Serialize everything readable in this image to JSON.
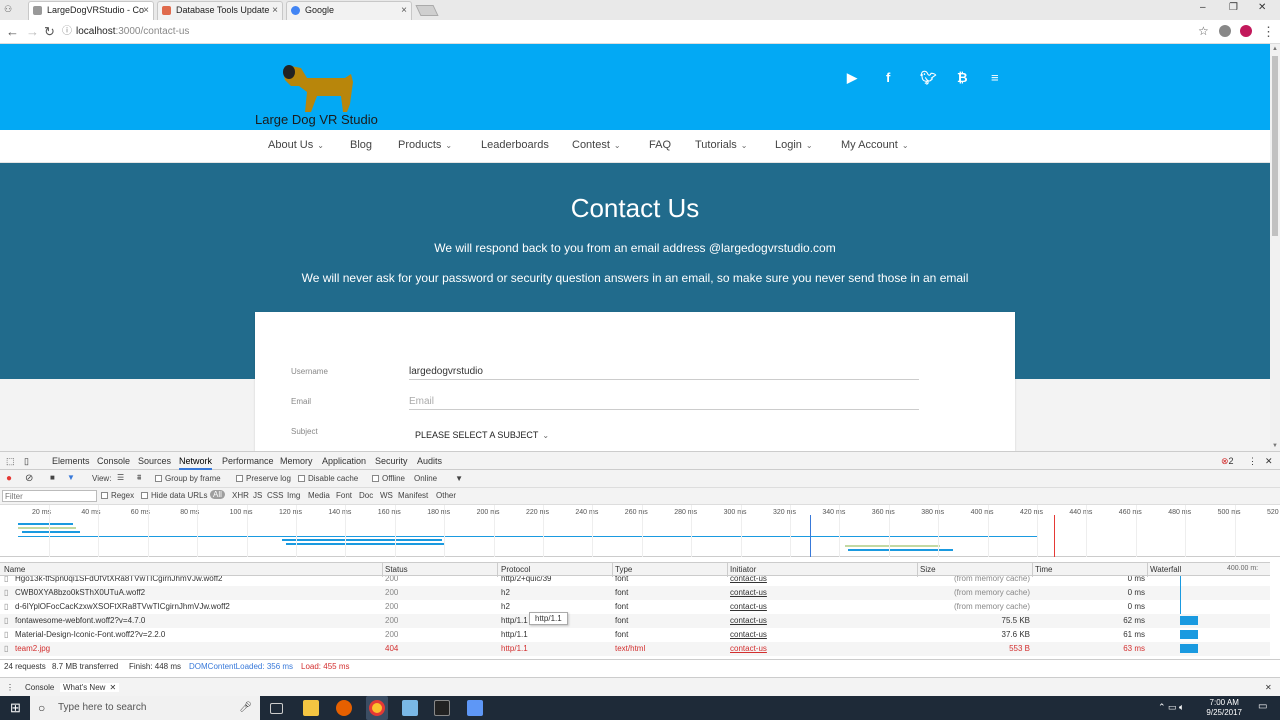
{
  "browser": {
    "tabs": [
      {
        "label": "LargeDogVRStudio - Co",
        "active": true
      },
      {
        "label": "Database Tools Update",
        "active": false
      },
      {
        "label": "Google",
        "active": false
      }
    ],
    "url_host": "localhost",
    "url_path": ":3000/contact-us"
  },
  "site": {
    "brand": "Large Dog VR Studio",
    "social": [
      "youtube-icon",
      "facebook-icon",
      "twitter-icon",
      "bitcoin-icon",
      "menu-icon"
    ],
    "nav": [
      "About Us",
      "Blog",
      "Products",
      "Leaderboards",
      "Contest",
      "FAQ",
      "Tutorials",
      "Login",
      "My Account"
    ],
    "hero": {
      "title": "Contact Us",
      "line1": "We will respond back to you from an email address @largedogvrstudio.com",
      "line2": "We will never ask for your password or security question answers in an email, so make sure you never send those in an email"
    },
    "form": {
      "username_label": "Username",
      "username_value": "largedogvrstudio",
      "email_label": "Email",
      "email_placeholder": "Email",
      "subject_label": "Subject",
      "subject_value": "PLEASE SELECT A SUBJECT"
    },
    "colors": {
      "header": "#03a9f4",
      "hero": "#216b8c"
    }
  },
  "devtools": {
    "tabs": [
      "Elements",
      "Console",
      "Sources",
      "Network",
      "Performance",
      "Memory",
      "Application",
      "Security",
      "Audits"
    ],
    "active_tab": "Network",
    "error_count": "2",
    "toolbar": {
      "view": "View:",
      "group_by_frame": "Group by frame",
      "preserve_log": "Preserve log",
      "disable_cache": "Disable cache",
      "offline": "Offline",
      "throttle": "Online"
    },
    "filter": {
      "placeholder": "Filter",
      "regex": "Regex",
      "hide_data_urls": "Hide data URLs",
      "types": [
        "All",
        "XHR",
        "JS",
        "CSS",
        "Img",
        "Media",
        "Font",
        "Doc",
        "WS",
        "Manifest",
        "Other"
      ]
    },
    "timeline_ticks": [
      "20 ms",
      "40 ms",
      "60 ms",
      "80 ms",
      "100 ms",
      "120 ms",
      "140 ms",
      "160 ms",
      "180 ms",
      "200 ms",
      "220 ms",
      "240 ms",
      "260 ms",
      "280 ms",
      "300 ms",
      "320 ms",
      "340 ms",
      "360 ms",
      "380 ms",
      "400 ms",
      "420 ms",
      "440 ms",
      "460 ms",
      "480 ms",
      "500 ms",
      "520"
    ],
    "columns": [
      "Name",
      "Status",
      "Protocol",
      "Type",
      "Initiator",
      "Size",
      "Time",
      "Waterfall"
    ],
    "waterfall_scale": "400.00 m:",
    "rows": [
      {
        "name": "Hgo13k-tfSpn0qi1SFdUfVtXRa8TVwTICgirnJhmVJw.woff2",
        "status": "200",
        "protocol": "http/2+quic/39",
        "type": "font",
        "initiator": "contact-us",
        "size": "(from memory cache)",
        "time": "0 ms",
        "wf_start": 0.133,
        "wf_width": 0.01,
        "error": false
      },
      {
        "name": "CWB0XYA8bzo0kSThX0UTuA.woff2",
        "status": "200",
        "protocol": "h2",
        "type": "font",
        "initiator": "contact-us",
        "size": "(from memory cache)",
        "time": "0 ms",
        "wf_start": 0.133,
        "wf_width": 0.01,
        "error": false
      },
      {
        "name": "d-6IYplOFocCacKzxwXSOFtXRa8TVwTICgirnJhmVJw.woff2",
        "status": "200",
        "protocol": "h2",
        "type": "font",
        "initiator": "contact-us",
        "size": "(from memory cache)",
        "time": "0 ms",
        "wf_start": 0.133,
        "wf_width": 0.01,
        "error": false
      },
      {
        "name": "fontawesome-webfont.woff2?v=4.7.0",
        "status": "200",
        "protocol": "http/1.1",
        "type": "font",
        "initiator": "contact-us",
        "size": "75.5 KB",
        "time": "62 ms",
        "wf_start": 0.133,
        "wf_width": 0.2,
        "error": false
      },
      {
        "name": "Material-Design-Iconic-Font.woff2?v=2.2.0",
        "status": "200",
        "protocol": "http/1.1",
        "type": "font",
        "initiator": "contact-us",
        "size": "37.6 KB",
        "time": "61 ms",
        "wf_start": 0.133,
        "wf_width": 0.2,
        "error": false
      },
      {
        "name": "team2.jpg",
        "status": "404",
        "protocol": "http/1.1",
        "type": "text/html",
        "initiator": "contact-us",
        "size": "553 B",
        "time": "63 ms",
        "wf_start": 0.133,
        "wf_width": 0.2,
        "error": true
      }
    ],
    "tooltip": "http/1.1",
    "status": {
      "requests": "24 requests",
      "transferred": "8.7 MB transferred",
      "finish": "Finish: 448 ms",
      "dcl": "DOMContentLoaded: 356 ms",
      "load": "Load: 455 ms"
    },
    "drawer": {
      "console": "Console",
      "whats_new": "What's New"
    }
  },
  "taskbar": {
    "search_placeholder": "Type here to search",
    "time": "7:00 AM",
    "date": "9/25/2017"
  }
}
